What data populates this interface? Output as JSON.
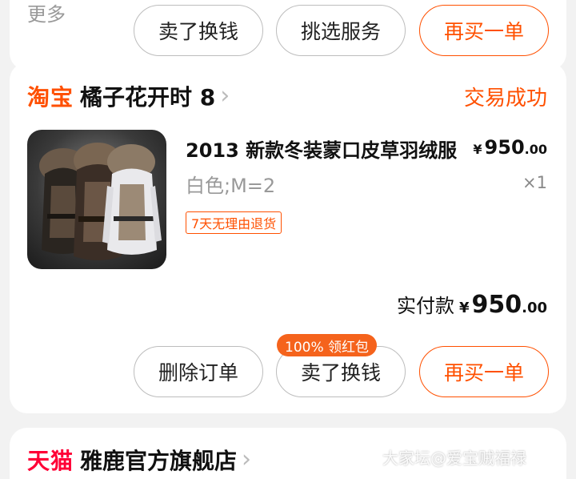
{
  "top_card": {
    "more_label": "更多",
    "buttons": [
      "卖了换钱",
      "挑选服务",
      "再买一单"
    ]
  },
  "order": {
    "platform": "淘宝",
    "shop_name": "橘子花开时 8",
    "status": "交易成功",
    "product": {
      "title": "2013 新款冬装蒙口皮草羽绒服",
      "price_currency": "¥",
      "price_int": "950",
      "price_dec": ".00",
      "sku": "白色;M=2",
      "quantity": "×1",
      "tag": "7天无理由退货"
    },
    "total_label": "实付款",
    "total_currency": "¥",
    "total_int": "950",
    "total_dec": ".00",
    "promo_badge": "100% 领红包",
    "buttons": {
      "delete": "删除订单",
      "sell": "卖了换钱",
      "rebuy": "再买一单"
    }
  },
  "next_order": {
    "platform": "天猫",
    "shop_name": "雅鹿官方旗舰店"
  },
  "watermark": "大家坛@爱宝贼福禄",
  "colors": {
    "accent": "#ff5000",
    "tmall": "#ff0036",
    "badge": "#f5631c"
  }
}
